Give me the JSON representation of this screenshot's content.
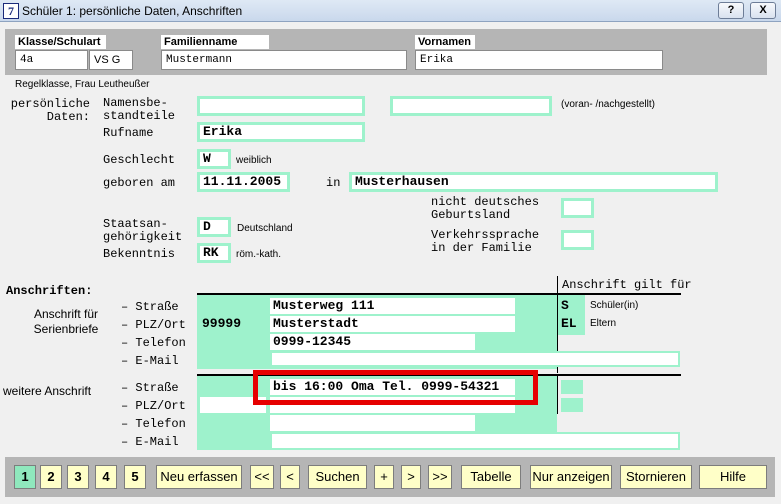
{
  "window": {
    "title": "Schüler 1:  persönliche Daten, Anschriften",
    "app_icon": "7",
    "help_btn": "?",
    "close_btn": "X"
  },
  "header": {
    "klasse_label": "Klasse/Schulart",
    "klasse_value": "4a",
    "schulart_value": "VS G",
    "familienname_label": "Familienname",
    "familienname_value": "Mustermann",
    "vornamen_label": "Vornamen",
    "vornamen_value": "Erika",
    "regelklasse": "Regelklasse,  Frau Leutheußer"
  },
  "personal": {
    "section_label_1": "persönliche",
    "section_label_2": "Daten:",
    "namensbestandteile_label_1": "Namensbe-",
    "namensbestandteile_label_2": "standteile",
    "voran_hint": "(voran- /nachgestellt)",
    "rufname_label": "Rufname",
    "rufname_value": "Erika",
    "geschlecht_label": "Geschlecht",
    "geschlecht_code": "W",
    "geschlecht_text": "weiblich",
    "geboren_label": "geboren am",
    "geboren_value": "11.11.2005",
    "in_label": "in",
    "geburtsort_value": "Musterhausen",
    "nicht_deutsch_label_1": "nicht deutsches",
    "nicht_deutsch_label_2": "Geburtsland",
    "staats_label_1": "Staatsan-",
    "staats_label_2": "gehörigkeit",
    "staats_code": "D",
    "staats_text": "Deutschland",
    "verkehrs_label_1": "Verkehrssprache",
    "verkehrs_label_2": "in der Familie",
    "bekenntnis_label": "Bekenntnis",
    "bekenntnis_code": "RK",
    "bekenntnis_text": "röm.-kath."
  },
  "addresses": {
    "section_label": "Anschriften:",
    "gilt_fuer_label": "Anschrift gilt für",
    "serien_label_1": "Anschrift für",
    "serien_label_2": "Serienbriefe",
    "weitere_label": "weitere Anschrift",
    "strasse_label": "– Straße",
    "plz_label": "– PLZ/Ort",
    "telefon_label": "– Telefon",
    "email_label": "– E-Mail",
    "primary": {
      "strasse": "Musterweg 111",
      "plz": "99999",
      "ort": "Musterstadt",
      "telefon": "0999-12345",
      "email": ""
    },
    "gilt": [
      {
        "code": "S",
        "text": "Schüler(in)"
      },
      {
        "code": "EL",
        "text": "Eltern"
      }
    ],
    "secondary": {
      "strasse": "bis 16:00 Oma Tel. 0999-54321",
      "plz": "",
      "ort": "",
      "telefon": "",
      "email": ""
    }
  },
  "toolbar": {
    "pages": [
      "1",
      "2",
      "3",
      "4",
      "5"
    ],
    "neu_erfassen": "Neu erfassen",
    "first": "<<",
    "prev": "<",
    "suchen": "Suchen",
    "plus": "+",
    "next": ">",
    "last": ">>",
    "tabelle": "Tabelle",
    "nur_anzeigen": "Nur anzeigen",
    "stornieren": "Stornieren",
    "hilfe": "Hilfe"
  },
  "colors": {
    "field_green": "#9ef2cc",
    "highlight_red": "#e60000",
    "button_yellow": "#ffffc8"
  }
}
